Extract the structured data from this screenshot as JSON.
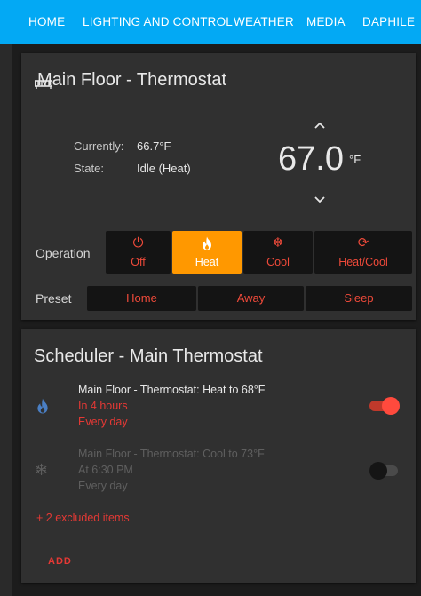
{
  "nav": {
    "tabs": [
      {
        "label": "HOME"
      },
      {
        "label": "LIGHTING AND CONTROL"
      },
      {
        "label": "WEATHER"
      },
      {
        "label": "MEDIA"
      },
      {
        "label": "DAPHILE"
      }
    ]
  },
  "thermostat": {
    "title": "Main Floor - Thermostat",
    "currently_label": "Currently:",
    "currently_value": "66.7°F",
    "state_label": "State:",
    "state_value": "Idle (Heat)",
    "target_temp": "67.0",
    "target_unit": "°F",
    "up_icon": "chevron-up-icon",
    "down_icon": "chevron-down-icon",
    "operation_label": "Operation",
    "operations": [
      {
        "label": "Off",
        "icon": "power-icon",
        "glyph": "⏻"
      },
      {
        "label": "Heat",
        "icon": "fire-icon",
        "glyph": "🔥",
        "active": true
      },
      {
        "label": "Cool",
        "icon": "snowflake-icon",
        "glyph": "❄"
      },
      {
        "label": "Heat/Cool",
        "icon": "sync-icon",
        "glyph": "⟳"
      }
    ],
    "preset_label": "Preset",
    "presets": [
      {
        "label": "Home"
      },
      {
        "label": "Away"
      },
      {
        "label": "Sleep"
      }
    ]
  },
  "scheduler": {
    "title": "Scheduler - Main Thermostat",
    "items": [
      {
        "icon": "fire-icon",
        "title": "Main Floor - Thermostat: Heat to 68°F",
        "time": "In 4 hours",
        "repeat": "Every day",
        "enabled": true
      },
      {
        "icon": "snowflake-icon",
        "title": "Main Floor - Thermostat: Cool to 73°F",
        "time": "At 6:30 PM",
        "repeat": "Every day",
        "enabled": false
      }
    ],
    "excluded_label": "+ 2 excluded items",
    "add_label": "ADD"
  },
  "colors": {
    "header": "#03a9f4",
    "accent_active": "#ff9800",
    "accent_red": "#e53935",
    "heat_icon_blue": "#4a7fc4"
  }
}
